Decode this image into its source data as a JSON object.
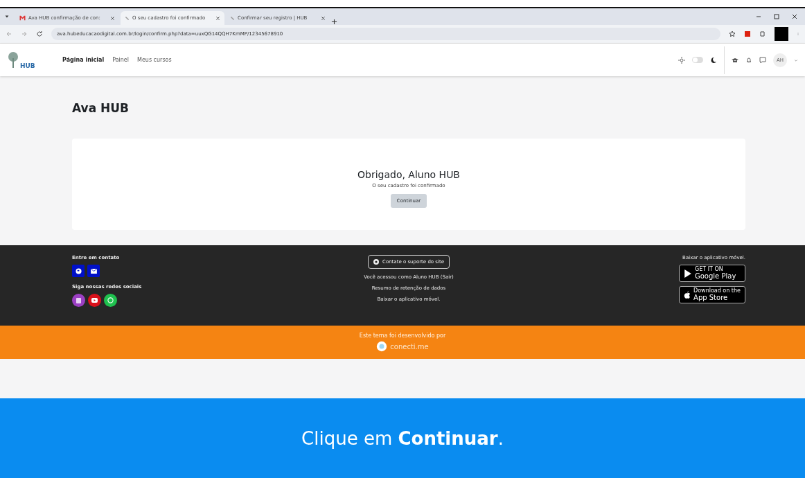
{
  "browser": {
    "tabs": [
      {
        "title": "Ava HUB confirmação de con:",
        "selected": false
      },
      {
        "title": "O seu cadastro foi confirmado",
        "selected": true
      },
      {
        "title": "Confirmar seu registro | HUB",
        "selected": false
      }
    ],
    "url": "ava.hubeducacaodigital.com.br/login/confirm.php?data=uuxQG14QQH7KmMP/12345678910"
  },
  "navbar": {
    "logo_text": "HUB",
    "links": [
      {
        "label": "Página inicial",
        "selected": true
      },
      {
        "label": "Painel",
        "selected": false
      },
      {
        "label": "Meus cursos",
        "selected": false
      }
    ],
    "dark_mode": {
      "on": false
    },
    "avatar": "AH"
  },
  "page": {
    "heading": "Ava HUB",
    "card": {
      "title": "Obrigado, Aluno HUB",
      "message": "O seu cadastro foi confirmado",
      "button": "Continuar"
    }
  },
  "footer": {
    "contact_title": "Entre em contato",
    "social_title": "Siga nossas redes sociais",
    "support_button": "Contate o suporte do site",
    "links": [
      "Você acessou como Aluno HUB (Sair)",
      "Resumo de retenção de dados",
      "Baixar o aplicativo móvel."
    ],
    "app_title": "Baixar o aplicativo móvel.",
    "stores": [
      {
        "kind": "google",
        "small": "GET IT ON",
        "big": "Google Play"
      },
      {
        "kind": "apple",
        "small": "Download on the",
        "big": "App Store"
      }
    ]
  },
  "credit": {
    "text": "Este tema foi desenvolvido por",
    "brand": "conecti.me"
  },
  "banner": {
    "text": "Clique em **Continuar**."
  }
}
